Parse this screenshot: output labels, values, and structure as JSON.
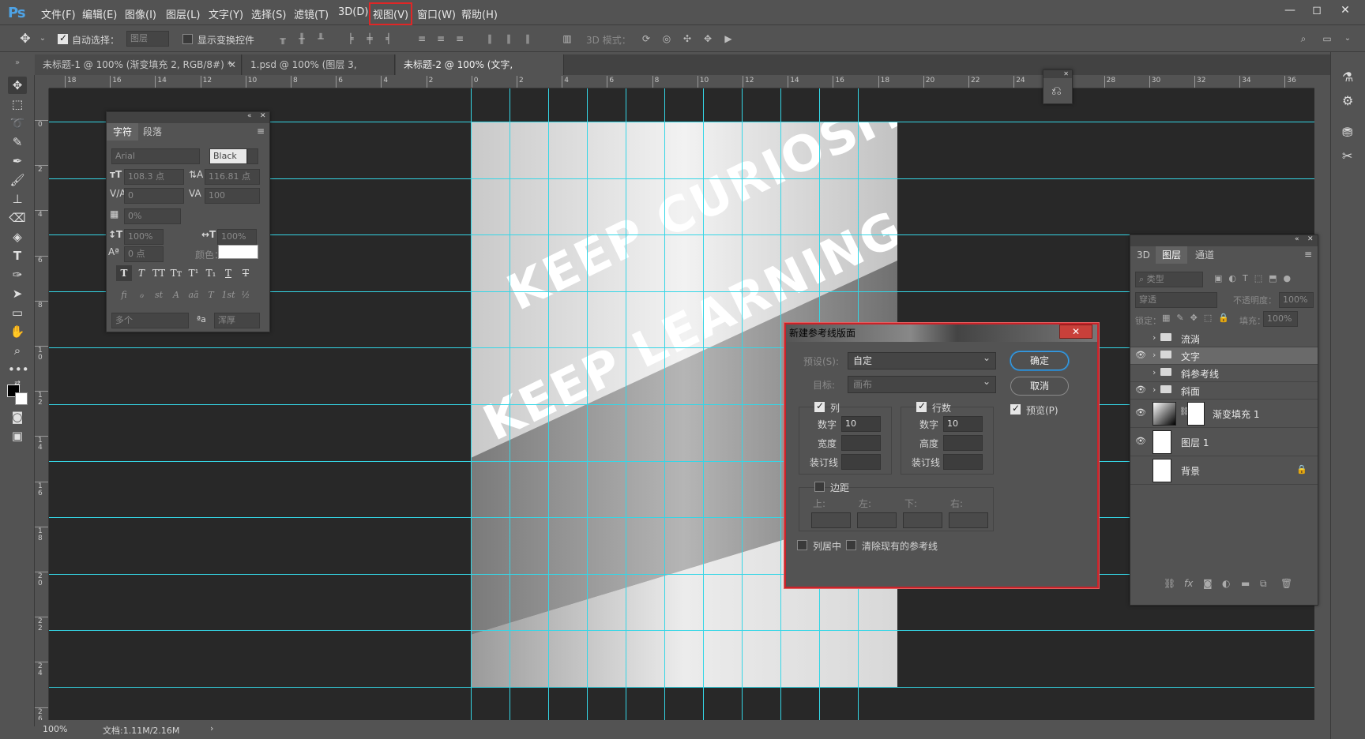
{
  "app": {
    "logo": "Ps"
  },
  "menubar": {
    "items": [
      "文件(F)",
      "编辑(E)",
      "图像(I)",
      "图层(L)",
      "文字(Y)",
      "选择(S)",
      "滤镜(T)",
      "3D(D)",
      "视图(V)",
      "窗口(W)",
      "帮助(H)"
    ],
    "highlighted": "视图(V)"
  },
  "options": {
    "auto_select_label": "自动选择：",
    "auto_select_value": "图层",
    "show_transform_label": "显示变换控件",
    "mode_3d_label": "3D 模式："
  },
  "tabs": [
    {
      "label": "未标题-1 @ 100% (渐变填充 2, RGB/8#) *",
      "active": false
    },
    {
      "label": "1.psd @ 100% (图层 3, RGB/8) *",
      "active": false
    },
    {
      "label": "未标题-2 @ 100% (文字, RGB/8#) *",
      "active": true
    }
  ],
  "ruler": {
    "h_ticks": [
      "18",
      "16",
      "14",
      "12",
      "10",
      "8",
      "6",
      "4",
      "2",
      "0",
      "2",
      "4",
      "6",
      "8",
      "10",
      "12",
      "14",
      "16",
      "18",
      "20",
      "22",
      "24",
      "26",
      "28",
      "30",
      "32",
      "34",
      "36"
    ],
    "v_ticks": [
      "0",
      "2",
      "4",
      "6",
      "8",
      "1\n0",
      "1\n2",
      "1\n4",
      "1\n6",
      "1\n8",
      "2\n0",
      "2\n2",
      "2\n4",
      "2\n6"
    ]
  },
  "canvas": {
    "text_line1": "KEEP CURIOSITY",
    "text_line2": "KEEP LEARNING",
    "guide_color": "#35d6e6"
  },
  "status": {
    "zoom": "100%",
    "doc_info": "文档:1.11M/2.16M"
  },
  "character_panel": {
    "tabs": [
      "字符",
      "段落"
    ],
    "font_family": "Arial",
    "font_style": "Black",
    "font_size": "108.3 点",
    "leading": "116.81 点",
    "kerning": "0",
    "tracking": "100",
    "tsume": "0%",
    "vscale": "100%",
    "hscale": "100%",
    "baseline": "0 点",
    "color_label": "颜色：",
    "language": "多个",
    "aa_label": "ªa",
    "antialias": "浑厚",
    "style_btns": [
      "T",
      "T",
      "TT",
      "Tт",
      "T¹",
      "T₁",
      "T",
      "T"
    ],
    "ot_btns": [
      "fi",
      "ℴ",
      "st",
      "A",
      "aā",
      "T",
      "1st",
      "½"
    ]
  },
  "layers_panel": {
    "tabs": [
      "3D",
      "图层",
      "通道"
    ],
    "filter": "类型",
    "blend_mode": "穿透",
    "opacity_label": "不透明度：",
    "opacity": "100%",
    "lock_label": "锁定：",
    "fill_label": "填充：",
    "fill": "100%",
    "layers": [
      {
        "name": "流淌",
        "type": "group",
        "visible": false,
        "selected": false
      },
      {
        "name": "文字",
        "type": "group",
        "visible": true,
        "selected": true
      },
      {
        "name": "斜参考线",
        "type": "group",
        "visible": false,
        "selected": false
      },
      {
        "name": "斜面",
        "type": "group",
        "visible": true,
        "selected": false
      },
      {
        "name": "渐变填充 1",
        "type": "adjustment",
        "visible": true,
        "selected": false
      },
      {
        "name": "图层 1",
        "type": "layer",
        "visible": true,
        "selected": false
      },
      {
        "name": "背景",
        "type": "background",
        "visible": false,
        "selected": false
      }
    ]
  },
  "dialog": {
    "title": "新建参考线版面",
    "close": "✕",
    "preset_label": "预设(S):",
    "preset_value": "自定",
    "target_label": "目标:",
    "target_value": "画布",
    "ok": "确定",
    "cancel": "取消",
    "preview_label": "预览(P)",
    "columns_label": "列",
    "rows_label": "行数",
    "number_label": "数字",
    "col_number": "10",
    "row_number": "10",
    "width_label": "宽度",
    "height_label": "高度",
    "gutter_label": "装订线",
    "margin_label": "边距",
    "top_label": "上:",
    "left_label": "左:",
    "bottom_label": "下:",
    "right_label": "右:",
    "center_cols_label": "列居中",
    "clear_guides_label": "清除现有的参考线"
  }
}
